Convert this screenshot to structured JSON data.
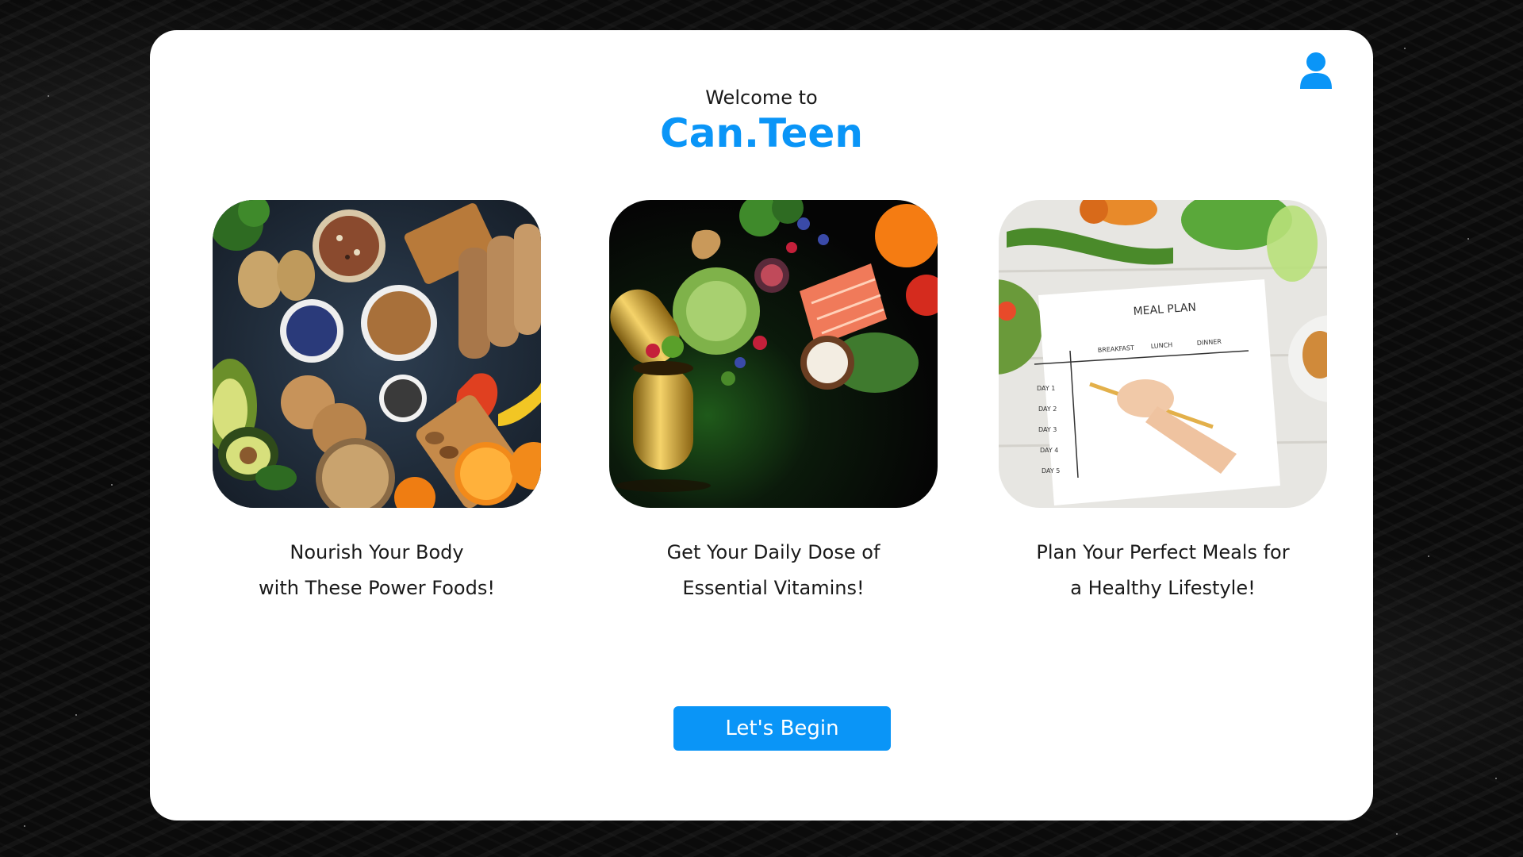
{
  "header": {
    "welcome_text": "Welcome to",
    "app_name": "Can.Teen"
  },
  "features": [
    {
      "image": "power-foods-photo",
      "caption_line1": "Nourish Your Body",
      "caption_line2": "with These Power Foods!"
    },
    {
      "image": "vitamins-capsule-photo",
      "caption_line1": "Get Your Daily Dose of",
      "caption_line2": "Essential Vitamins!"
    },
    {
      "image": "meal-plan-photo",
      "caption_line1": "Plan Your Perfect Meals for",
      "caption_line2": "a Healthy Lifestyle!"
    }
  ],
  "meal_plan_sheet": {
    "title": "MEAL PLAN",
    "columns": [
      "BREAKFAST",
      "LUNCH",
      "DINNER"
    ],
    "rows": [
      "DAY 1",
      "DAY 2",
      "DAY 3",
      "DAY 4",
      "DAY 5"
    ]
  },
  "cta": {
    "label": "Let's Begin"
  },
  "icons": {
    "user": "user-icon"
  },
  "colors": {
    "accent": "#0a95f7",
    "card_background": "#ffffff",
    "page_background": "#0b0b0b"
  }
}
